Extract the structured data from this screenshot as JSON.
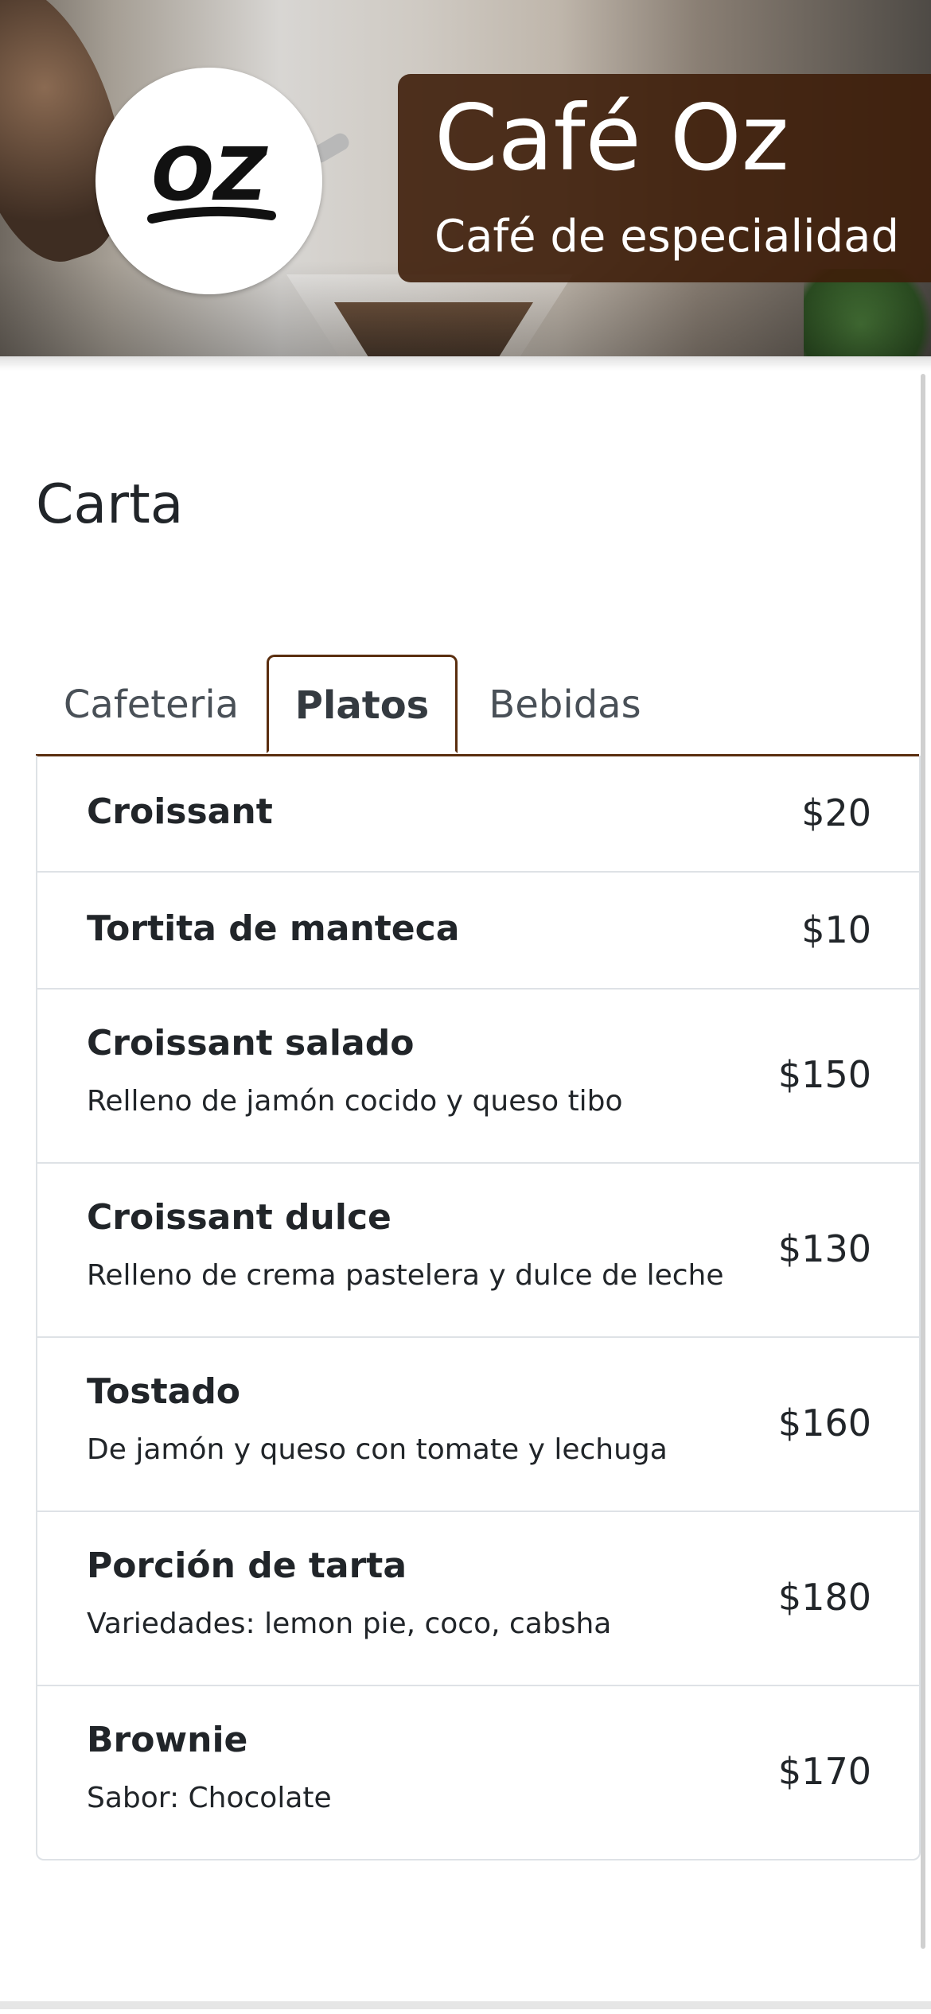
{
  "header": {
    "title": "Café Oz",
    "subtitle": "Café de especialidad",
    "logo_text": "OZ",
    "accent_color": "#5a2e0f"
  },
  "menu": {
    "section_title": "Carta",
    "tabs": [
      {
        "label": "Cafeteria",
        "active": false
      },
      {
        "label": "Platos",
        "active": true
      },
      {
        "label": "Bebidas",
        "active": false
      }
    ],
    "items": [
      {
        "name": "Croissant",
        "description": "",
        "price": "$20"
      },
      {
        "name": "Tortita de manteca",
        "description": "",
        "price": "$10"
      },
      {
        "name": "Croissant salado",
        "description": "Relleno de jamón cocido y queso tibo",
        "price": "$150"
      },
      {
        "name": "Croissant dulce",
        "description": "Relleno de crema pastelera y dulce de leche",
        "price": "$130"
      },
      {
        "name": "Tostado",
        "description": "De jamón y queso con tomate y lechuga",
        "price": "$160"
      },
      {
        "name": "Porción de tarta",
        "description": "Variedades: lemon pie, coco, cabsha",
        "price": "$180"
      },
      {
        "name": "Brownie",
        "description": "Sabor: Chocolate",
        "price": "$170"
      }
    ]
  }
}
